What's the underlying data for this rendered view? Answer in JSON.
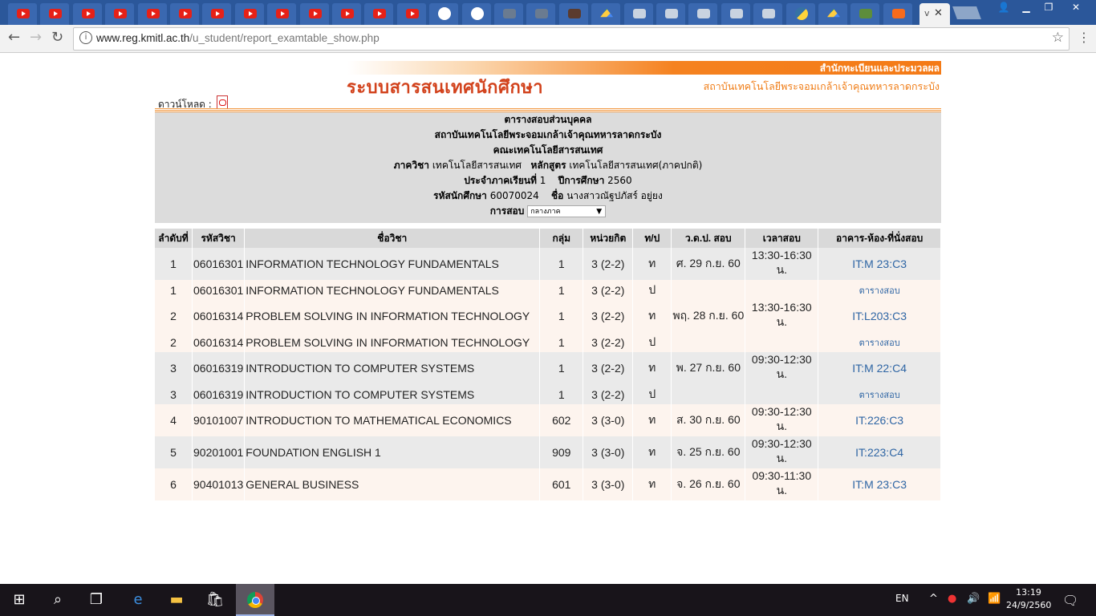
{
  "browser": {
    "tabs": [
      {
        "icon": "youtube-icon",
        "kind": "yt"
      },
      {
        "icon": "youtube-icon",
        "kind": "yt"
      },
      {
        "icon": "youtube-icon",
        "kind": "yt"
      },
      {
        "icon": "youtube-icon",
        "kind": "yt"
      },
      {
        "icon": "youtube-icon",
        "kind": "yt"
      },
      {
        "icon": "youtube-icon",
        "kind": "yt"
      },
      {
        "icon": "youtube-icon",
        "kind": "yt"
      },
      {
        "icon": "youtube-icon",
        "kind": "yt"
      },
      {
        "icon": "youtube-icon",
        "kind": "yt"
      },
      {
        "icon": "youtube-icon",
        "kind": "yt"
      },
      {
        "icon": "youtube-icon",
        "kind": "yt"
      },
      {
        "icon": "youtube-icon",
        "kind": "yt"
      },
      {
        "icon": "youtube-icon",
        "kind": "yt"
      },
      {
        "icon": "github-icon",
        "kind": "gh"
      },
      {
        "icon": "github-icon",
        "kind": "gh"
      },
      {
        "icon": "document-icon",
        "kind": "doc"
      },
      {
        "icon": "document-icon",
        "kind": "doc"
      },
      {
        "icon": "profile-icon",
        "kind": "dark"
      },
      {
        "icon": "google-drive-icon",
        "kind": "drv"
      },
      {
        "icon": "page-icon",
        "kind": "gen"
      },
      {
        "icon": "page-icon",
        "kind": "gen"
      },
      {
        "icon": "page-icon",
        "kind": "gen"
      },
      {
        "icon": "page-icon",
        "kind": "gen"
      },
      {
        "icon": "page-icon",
        "kind": "gen"
      },
      {
        "icon": "python-icon",
        "kind": "py"
      },
      {
        "icon": "google-drive-icon",
        "kind": "drv"
      },
      {
        "icon": "spreadsheet-icon",
        "kind": "t16"
      },
      {
        "icon": "moodle-icon",
        "kind": "ms"
      }
    ],
    "active_tab_label": "v",
    "url_host": "www.reg.kmitl.ac.th",
    "url_path": "/u_student/report_examtable_show.php"
  },
  "page": {
    "office": "สำนักทะเบียนและประมวลผล",
    "system_title": "ระบบสารสนเทศนักศึกษา",
    "institute_banner": "สถาบันเทคโนโลยีพระจอมเกล้าเจ้าคุณทหารลาดกระบัง",
    "download_label": "ดาวน์โหลด :",
    "info": {
      "heading": "ตารางสอบส่วนบุคคล",
      "institute": "สถาบันเทคโนโลยีพระจอมเกล้าเจ้าคุณทหารลาดกระบัง",
      "faculty": "คณะเทคโนโลยีสารสนเทศ",
      "department_label": "ภาควิชา",
      "department": "เทคโนโลยีสารสนเทศ",
      "curriculum_label": "หลักสูตร",
      "curriculum": "เทคโนโลยีสารสนเทศ(ภาคปกติ)",
      "semester_label": "ประจำภาคเรียนที่",
      "semester": "1",
      "year_label": "ปีการศึกษา",
      "year": "2560",
      "student_id_label": "รหัสนักศึกษา",
      "student_id": "60070024",
      "name_label": "ชื่อ",
      "name": "นางสาวณัฐปภัสร์ อยู่ยง",
      "exam_label": "การสอบ",
      "exam_selected": "กลางภาค"
    },
    "columns": [
      "ลำดับที่",
      "รหัสวิชา",
      "ชื่อวิชา",
      "กลุ่ม",
      "หน่วยกิต",
      "ท/ป",
      "ว.ด.ป. สอบ",
      "เวลาสอบ",
      "อาคาร-ห้อง-ที่นั่งสอบ"
    ],
    "rows": [
      {
        "no": "1",
        "code": "06016301",
        "name": "INFORMATION TECHNOLOGY FUNDAMENTALS",
        "group": "1",
        "credit": "3 (2-2)",
        "tp": "ท",
        "date": "ศ. 29 ก.ย. 60",
        "time": "13:30-16:30 น.",
        "room": "IT:M 23:C3",
        "link": false
      },
      {
        "no": "1",
        "code": "06016301",
        "name": "INFORMATION TECHNOLOGY FUNDAMENTALS",
        "group": "1",
        "credit": "3 (2-2)",
        "tp": "ป",
        "date": "",
        "time": "",
        "room": "ตารางสอบ",
        "link": true
      },
      {
        "no": "2",
        "code": "06016314",
        "name": "PROBLEM SOLVING IN INFORMATION TECHNOLOGY",
        "group": "1",
        "credit": "3 (2-2)",
        "tp": "ท",
        "date": "พฤ. 28 ก.ย. 60",
        "time": "13:30-16:30 น.",
        "room": "IT:L203:C3",
        "link": false
      },
      {
        "no": "2",
        "code": "06016314",
        "name": "PROBLEM SOLVING IN INFORMATION TECHNOLOGY",
        "group": "1",
        "credit": "3 (2-2)",
        "tp": "ป",
        "date": "",
        "time": "",
        "room": "ตารางสอบ",
        "link": true
      },
      {
        "no": "3",
        "code": "06016319",
        "name": "INTRODUCTION TO COMPUTER SYSTEMS",
        "group": "1",
        "credit": "3 (2-2)",
        "tp": "ท",
        "date": "พ. 27 ก.ย. 60",
        "time": "09:30-12:30 น.",
        "room": "IT:M 22:C4",
        "link": false
      },
      {
        "no": "3",
        "code": "06016319",
        "name": "INTRODUCTION TO COMPUTER SYSTEMS",
        "group": "1",
        "credit": "3 (2-2)",
        "tp": "ป",
        "date": "",
        "time": "",
        "room": "ตารางสอบ",
        "link": true
      },
      {
        "no": "4",
        "code": "90101007",
        "name": "INTRODUCTION TO MATHEMATICAL ECONOMICS",
        "group": "602",
        "credit": "3 (3-0)",
        "tp": "ท",
        "date": "ส. 30 ก.ย. 60",
        "time": "09:30-12:30 น.",
        "room": "IT:226:C3",
        "link": false
      },
      {
        "no": "5",
        "code": "90201001",
        "name": "FOUNDATION ENGLISH 1",
        "group": "909",
        "credit": "3 (3-0)",
        "tp": "ท",
        "date": "จ. 25 ก.ย. 60",
        "time": "09:30-12:30 น.",
        "room": "IT:223:C4",
        "link": false
      },
      {
        "no": "6",
        "code": "90401013",
        "name": "GENERAL BUSINESS",
        "group": "601",
        "credit": "3 (3-0)",
        "tp": "ท",
        "date": "จ. 26 ก.ย. 60",
        "time": "09:30-11:30 น.",
        "room": "IT:M 23:C3",
        "link": false
      }
    ]
  },
  "taskbar": {
    "language": "EN",
    "time": "13:19",
    "date": "24/9/2560"
  }
}
